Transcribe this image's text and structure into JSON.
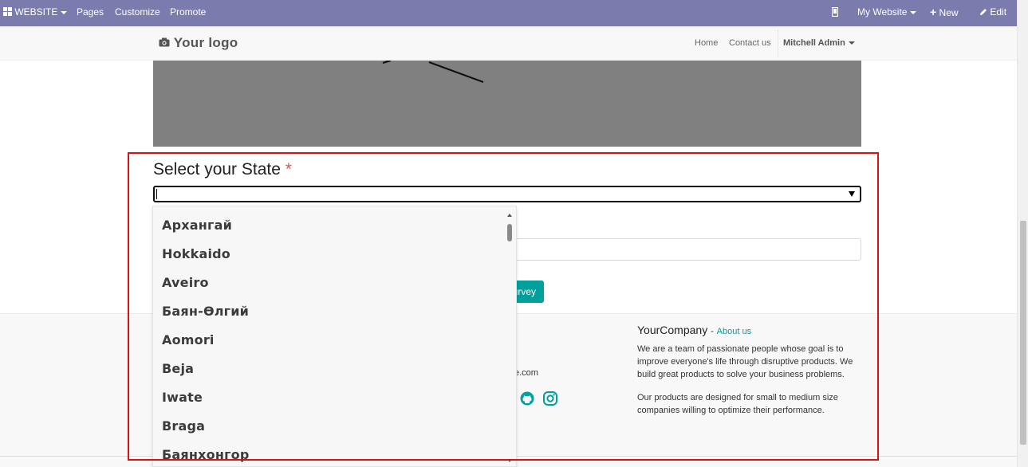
{
  "topbar": {
    "website_menu": "WEBSITE",
    "pages": "Pages",
    "customize": "Customize",
    "promote": "Promote",
    "my_website": "My Website",
    "new": "New",
    "edit": "Edit"
  },
  "navbar": {
    "logo": "Your logo",
    "links": [
      "Home",
      "Contact us"
    ],
    "user": "Mitchell Admin"
  },
  "question": {
    "title": "Select your State",
    "required_mark": "*",
    "select_value": ""
  },
  "dropdown": {
    "options": [
      "Архангай",
      "Hokkaido",
      "Aveiro",
      "Баян-Өлгий",
      "Aomori",
      "Beja",
      "Iwate",
      "Braga",
      "Баянхонгор"
    ]
  },
  "submit_button": {
    "label": "urvey"
  },
  "footer": {
    "email_fragment": "e.com",
    "company_name": "YourCompany",
    "about_separator": "-",
    "about_link": "About us",
    "paragraph_1": "We are a team of passionate people whose goal is to improve everyone's life through disruptive products. We build great products to solve your business problems.",
    "paragraph_2": "Our products are designed for small to medium size companies willing to optimize their performance."
  },
  "colors": {
    "topbar": "#7c7bad",
    "accent": "#00a09d",
    "highlight": "#dd1111",
    "required": "#e05353"
  }
}
